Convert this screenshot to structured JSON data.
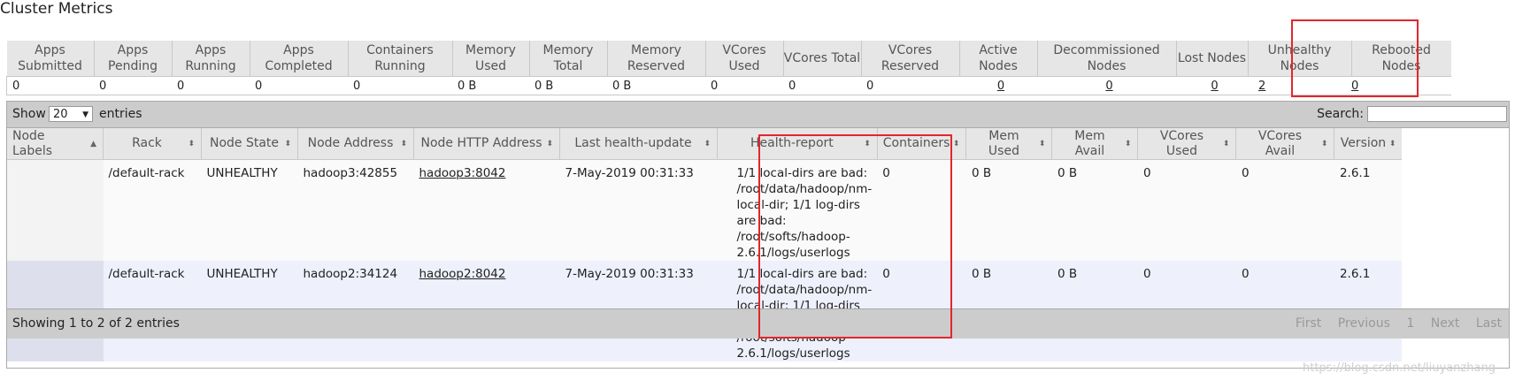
{
  "title": "Cluster Metrics",
  "metrics": {
    "headers": [
      "Apps Submitted",
      "Apps Pending",
      "Apps Running",
      "Apps Completed",
      "Containers Running",
      "Memory Used",
      "Memory Total",
      "Memory Reserved",
      "VCores Used",
      "VCores Total",
      "VCores Reserved",
      "Active Nodes",
      "Decommissioned Nodes",
      "Lost Nodes",
      "Unhealthy Nodes",
      "Rebooted Nodes"
    ],
    "values": [
      "0",
      "0",
      "0",
      "0",
      "0",
      "0 B",
      "0 B",
      "0 B",
      "0",
      "0",
      "0",
      "0",
      "0",
      "0",
      "2",
      "0"
    ]
  },
  "toolbar": {
    "show_label": "Show",
    "entries_value": "20",
    "entries_label": "entries",
    "search_label": "Search:",
    "search_value": ""
  },
  "nodes_table": {
    "columns": [
      "Node Labels",
      "Rack",
      "Node State",
      "Node Address",
      "Node HTTP Address",
      "Last health-update",
      "Health-report",
      "Containers",
      "Mem Used",
      "Mem Avail",
      "VCores Used",
      "VCores Avail",
      "Version"
    ],
    "rows": [
      {
        "node_labels": "",
        "rack": "/default-rack",
        "state": "UNHEALTHY",
        "address": "hadoop3:42855",
        "http_address": "hadoop3:8042",
        "last_update": "7-May-2019 00:31:33",
        "health_report": "1/1 local-dirs are bad: /root/data/hadoop/nm-local-dir; 1/1 log-dirs are bad: /root/softs/hadoop-2.6.1/logs/userlogs",
        "containers": "0",
        "mem_used": "0 B",
        "mem_avail": "0 B",
        "vcores_used": "0",
        "vcores_avail": "0",
        "version": "2.6.1"
      },
      {
        "node_labels": "",
        "rack": "/default-rack",
        "state": "UNHEALTHY",
        "address": "hadoop2:34124",
        "http_address": "hadoop2:8042",
        "last_update": "7-May-2019 00:31:33",
        "health_report": "1/1 local-dirs are bad: /root/data/hadoop/nm-local-dir; 1/1 log-dirs are bad: /root/softs/hadoop-2.6.1/logs/userlogs",
        "containers": "0",
        "mem_used": "0 B",
        "mem_avail": "0 B",
        "vcores_used": "0",
        "vcores_avail": "0",
        "version": "2.6.1"
      }
    ]
  },
  "footer": {
    "info": "Showing 1 to 2 of 2 entries",
    "pager": {
      "first": "First",
      "previous": "Previous",
      "page": "1",
      "next": "Next",
      "last": "Last"
    }
  },
  "watermark": "https://blog.csdn.net/liuyanzhang",
  "colors": {
    "highlight": "#e3262b",
    "toolbar": "#cccccc",
    "header": "#e6e6e6"
  }
}
